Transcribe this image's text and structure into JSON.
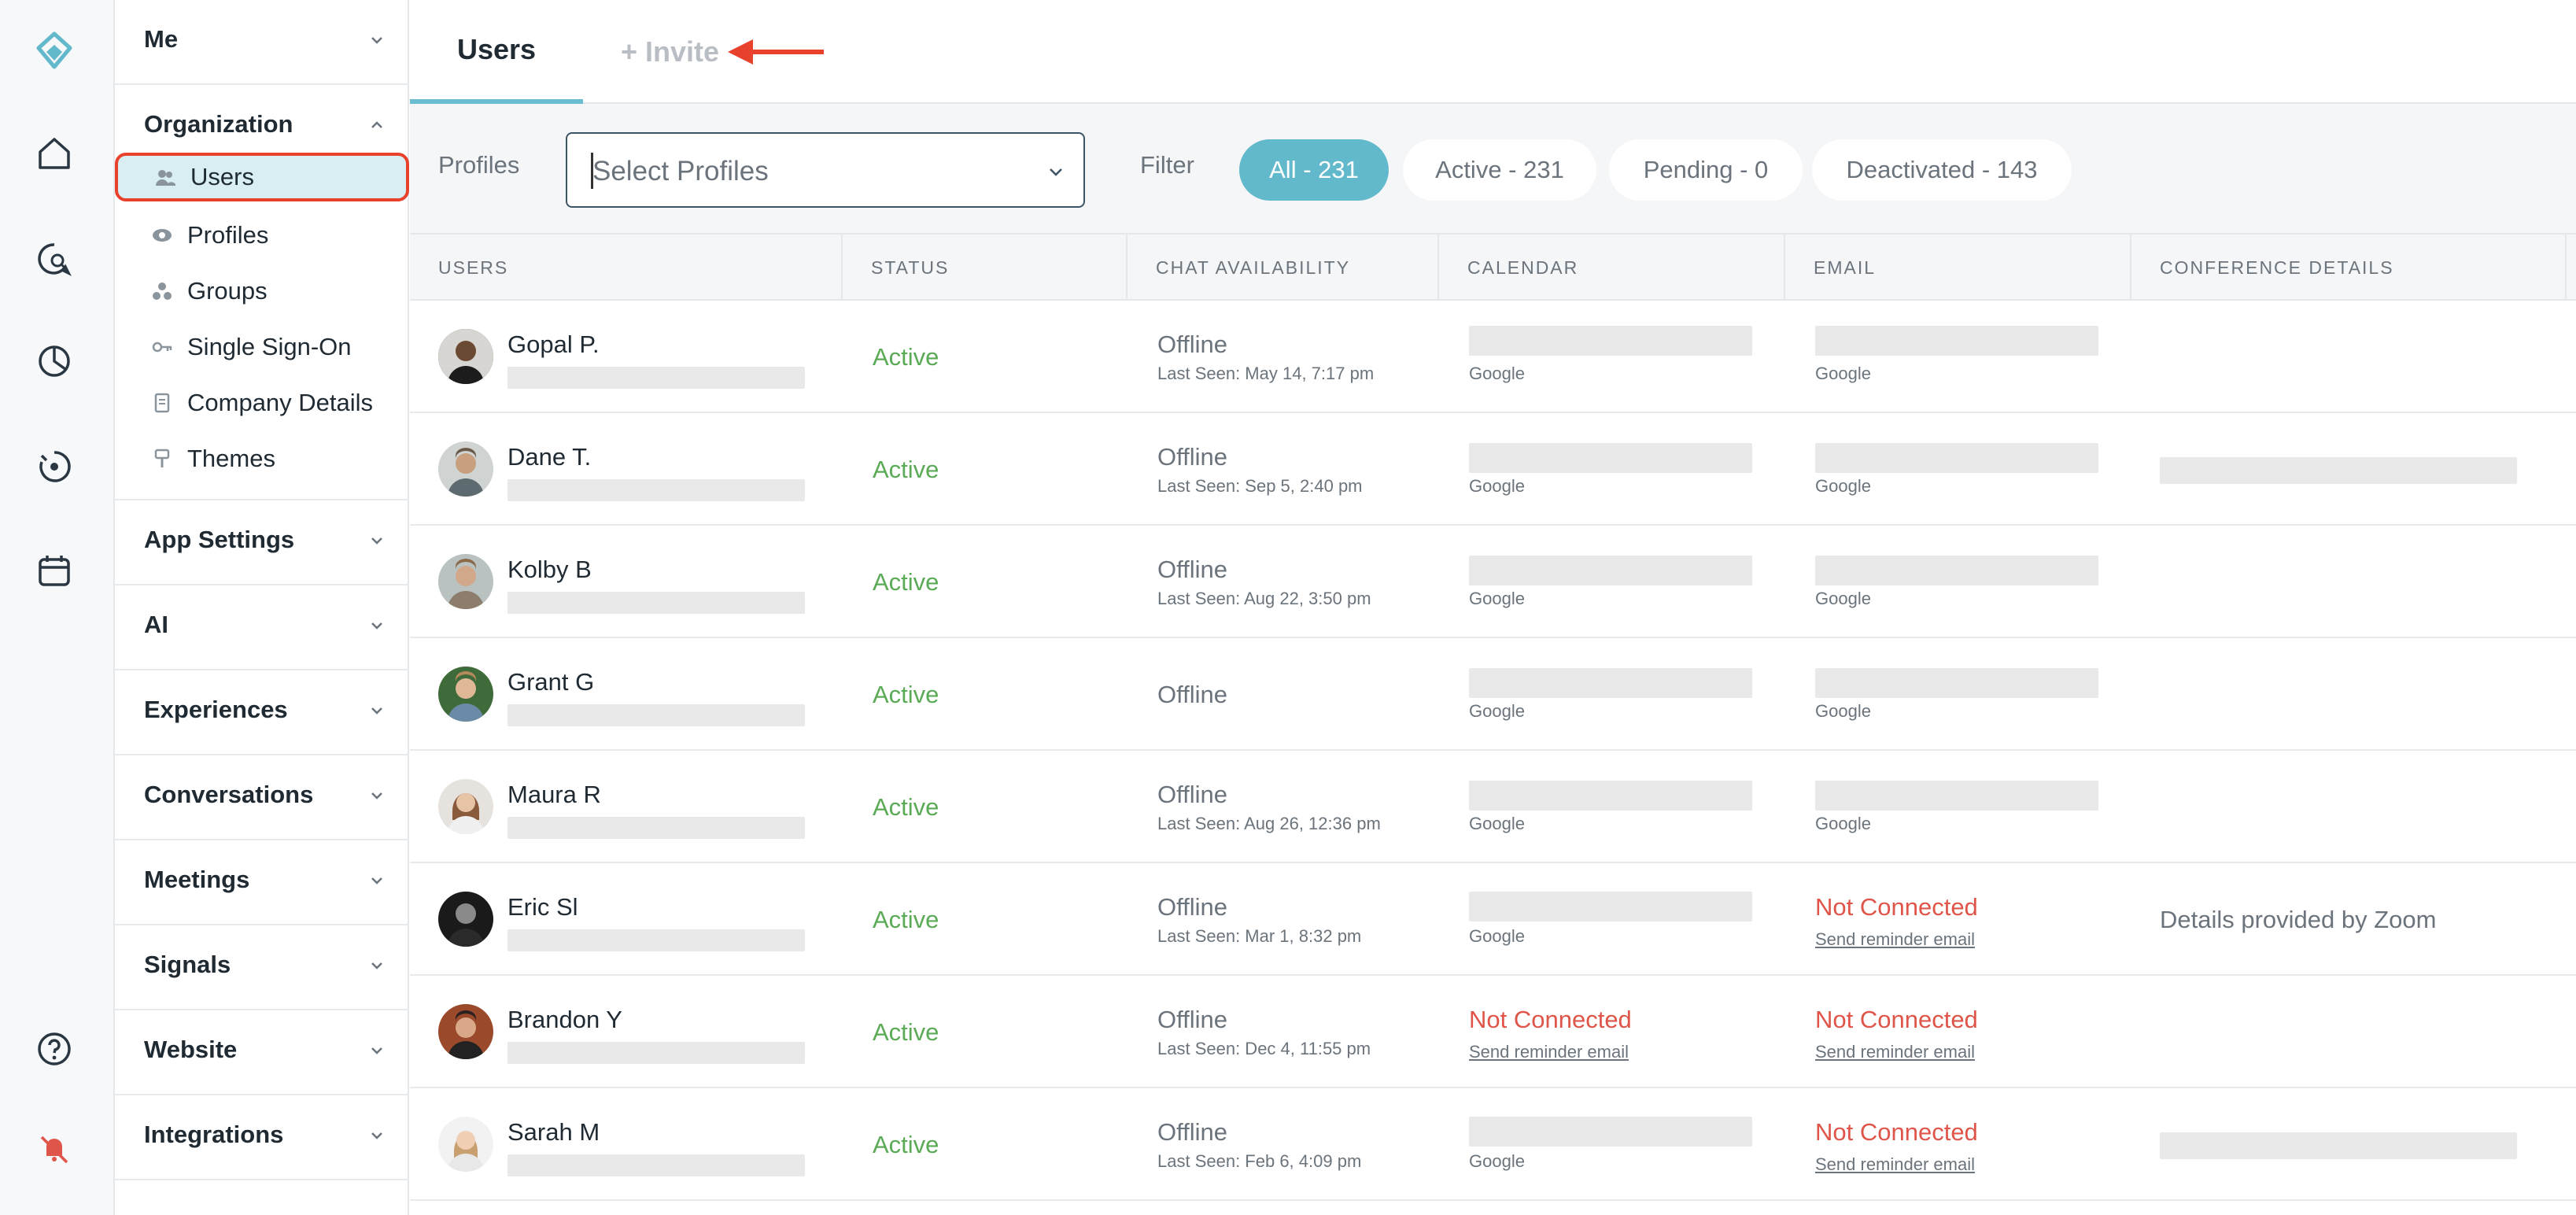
{
  "sidebar": {
    "me": "Me",
    "organization": "Organization",
    "org_items": [
      "Users",
      "Profiles",
      "Groups",
      "Single Sign-On",
      "Company Details",
      "Themes"
    ],
    "sections": [
      "App Settings",
      "AI",
      "Experiences",
      "Conversations",
      "Meetings",
      "Signals",
      "Website",
      "Integrations"
    ]
  },
  "tabs": {
    "users": "Users",
    "invite": "+ Invite"
  },
  "filters": {
    "profiles_label": "Profiles",
    "profiles_placeholder": "Select Profiles",
    "filter_label": "Filter",
    "pills": [
      "All - 231",
      "Active - 231",
      "Pending - 0",
      "Deactivated - 143"
    ]
  },
  "table": {
    "headers": [
      "USERS",
      "STATUS",
      "CHAT AVAILABILITY",
      "CALENDAR",
      "EMAIL",
      "CONFERENCE DETAILS"
    ],
    "rows": [
      {
        "name": "Gopal P.",
        "status": "Active",
        "chat": "Offline",
        "seen": "Last Seen: May 14, 7:17 pm",
        "calendar": "Google",
        "email": "Google",
        "calendar_connected": true,
        "email_connected": true,
        "conference": ""
      },
      {
        "name": "Dane T.",
        "status": "Active",
        "chat": "Offline",
        "seen": "Last Seen: Sep 5, 2:40 pm",
        "calendar": "Google",
        "email": "Google",
        "calendar_connected": true,
        "email_connected": true,
        "conference": ""
      },
      {
        "name": "Kolby B",
        "status": "Active",
        "chat": "Offline",
        "seen": "Last Seen: Aug 22, 3:50 pm",
        "calendar": "Google",
        "email": "Google",
        "calendar_connected": true,
        "email_connected": true,
        "conference": ""
      },
      {
        "name": "Grant G",
        "status": "Active",
        "chat": "Offline",
        "seen": "",
        "calendar": "Google",
        "email": "Google",
        "calendar_connected": true,
        "email_connected": true,
        "conference": ""
      },
      {
        "name": "Maura R",
        "status": "Active",
        "chat": "Offline",
        "seen": "Last Seen: Aug 26, 12:36 pm",
        "calendar": "Google",
        "email": "Google",
        "calendar_connected": true,
        "email_connected": true,
        "conference": ""
      },
      {
        "name": "Eric Sl",
        "status": "Active",
        "chat": "Offline",
        "seen": "Last Seen: Mar 1, 8:32 pm",
        "calendar": "Google",
        "email": "Not Connected",
        "calendar_connected": true,
        "email_connected": false,
        "conference": "Details provided by Zoom"
      },
      {
        "name": "Brandon Y",
        "status": "Active",
        "chat": "Offline",
        "seen": "Last Seen: Dec 4, 11:55 pm",
        "calendar": "Not Connected",
        "email": "Not Connected",
        "calendar_connected": false,
        "email_connected": false,
        "conference": ""
      },
      {
        "name": "Sarah M",
        "status": "Active",
        "chat": "Offline",
        "seen": "Last Seen: Feb 6, 4:09 pm",
        "calendar": "Google",
        "email": "Not Connected",
        "calendar_connected": true,
        "email_connected": false,
        "conference": ""
      }
    ],
    "reminder_label": "Send reminder email"
  },
  "colors": {
    "accent": "#63b9cc",
    "active_green": "#5aaa56",
    "error_red": "#e0554a",
    "highlight": "#e8412c"
  }
}
